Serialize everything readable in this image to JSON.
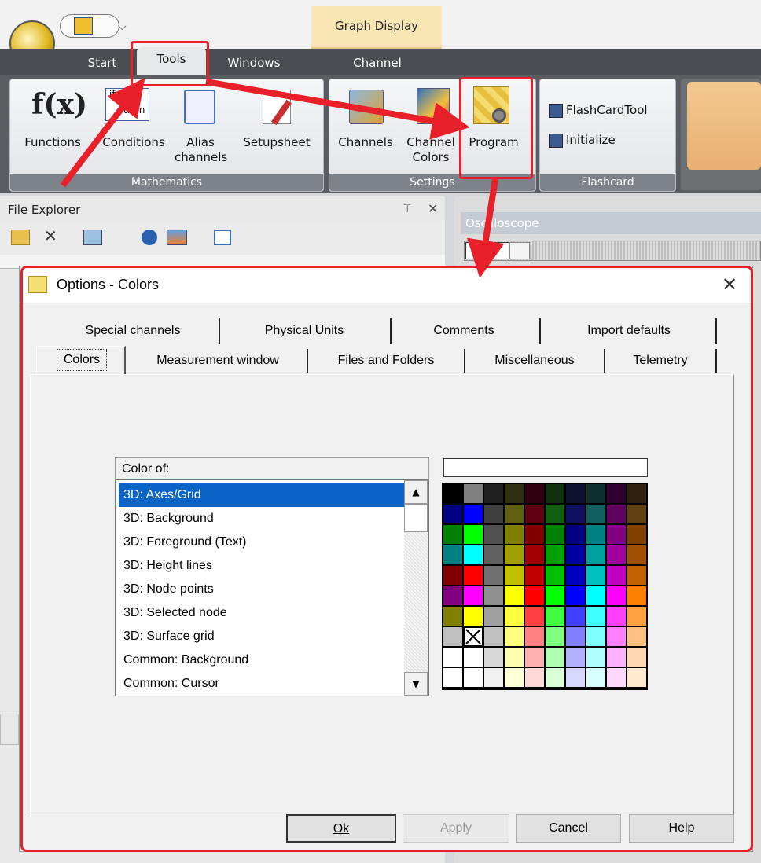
{
  "ribbon": {
    "context_header": "Graph Display",
    "tabs": [
      "Start",
      "Tools",
      "Windows",
      "Channel"
    ],
    "groups": {
      "mathematics": {
        "label": "Mathematics",
        "buttons": [
          "Functions",
          "Conditions",
          "Alias channels",
          "Setupsheet"
        ]
      },
      "settings": {
        "label": "Settings",
        "buttons": [
          "Channels",
          "Channel Colors",
          "Program"
        ]
      },
      "flashcard": {
        "label": "Flashcard",
        "buttons": [
          "FlashCardTool",
          "Initialize"
        ]
      }
    },
    "icon_text": {
      "fx": "f(x)",
      "if": "if",
      "then": "then"
    }
  },
  "file_explorer": {
    "title": "File Explorer",
    "pin": "⍑",
    "close": "✕"
  },
  "oscilloscope": {
    "title": "Oscilloscope"
  },
  "dialog": {
    "title": "Options - Colors",
    "close": "✕",
    "tabs_back": [
      "Special channels",
      "Physical Units",
      "Comments",
      "Import defaults"
    ],
    "tabs_front": [
      "Colors",
      "Measurement window",
      "Files and Folders",
      "Miscellaneous",
      "Telemetry"
    ],
    "active_tab": "Colors",
    "color_of_label": "Color of:",
    "color_items": [
      "3D: Axes/Grid",
      "3D: Background",
      "3D: Foreground (Text)",
      "3D: Height lines",
      "3D: Node points",
      "3D: Selected node",
      "3D: Surface grid",
      "Common: Background",
      "Common: Cursor"
    ],
    "selected_item": "3D: Axes/Grid",
    "buttons": {
      "ok": "Ok",
      "apply": "Apply",
      "cancel": "Cancel",
      "help": "Help"
    }
  },
  "palette_rows": [
    [
      "#000000",
      "#808080",
      "#202020",
      "#303010",
      "#300010",
      "#103010",
      "#101030",
      "#103030",
      "#300030",
      "#302010"
    ],
    [
      "#000080",
      "#0000ff",
      "#404040",
      "#606010",
      "#600010",
      "#106010",
      "#101060",
      "#106060",
      "#600060",
      "#604010"
    ],
    [
      "#008000",
      "#00ff00",
      "#505050",
      "#808000",
      "#800000",
      "#008000",
      "#000080",
      "#008080",
      "#800080",
      "#804000"
    ],
    [
      "#008080",
      "#00ffff",
      "#606060",
      "#a0a000",
      "#a00000",
      "#00a000",
      "#0000a0",
      "#00a0a0",
      "#a000a0",
      "#a05000"
    ],
    [
      "#800000",
      "#ff0000",
      "#707070",
      "#c0c000",
      "#c00000",
      "#00c000",
      "#0000c0",
      "#00c0c0",
      "#c000c0",
      "#c06000"
    ],
    [
      "#800080",
      "#ff00ff",
      "#909090",
      "#ffff00",
      "#ff0000",
      "#00ff00",
      "#0000ff",
      "#00ffff",
      "#ff00ff",
      "#ff8000"
    ],
    [
      "#808000",
      "#ffff00",
      "#a0a0a0",
      "#ffff40",
      "#ff4040",
      "#40ff40",
      "#4040ff",
      "#40ffff",
      "#ff40ff",
      "#ffa040"
    ],
    [
      "#c0c0c0",
      "#ffffff",
      "#c0c0c0",
      "#ffff80",
      "#ff8080",
      "#80ff80",
      "#8080ff",
      "#80ffff",
      "#ff80ff",
      "#ffc080"
    ],
    [
      "#ffffff",
      "#ffffff",
      "#d8d8d8",
      "#ffffb0",
      "#ffb0b0",
      "#b0ffb0",
      "#b0b0ff",
      "#b0ffff",
      "#ffb0ff",
      "#ffd8b0"
    ],
    [
      "#ffffff",
      "#ffffff",
      "#f0f0f0",
      "#ffffd8",
      "#ffd8d8",
      "#d8ffd8",
      "#d8d8ff",
      "#d8ffff",
      "#ffd8ff",
      "#ffe8d0"
    ]
  ],
  "colors": {
    "highlight": "#e8202a",
    "selection": "#0a64c8"
  }
}
